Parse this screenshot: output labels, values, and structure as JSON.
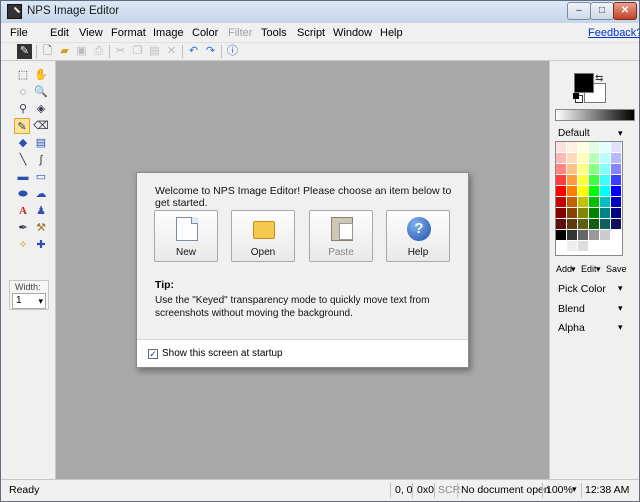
{
  "window": {
    "title": "NPS Image Editor",
    "controls": [
      "–",
      "□",
      "✕"
    ]
  },
  "menu": {
    "items": [
      "File",
      "Edit",
      "View",
      "Format",
      "Image",
      "Color",
      "Filter",
      "Tools",
      "Script",
      "Window",
      "Help"
    ],
    "disabled_item": "Filter",
    "feedback_link": "Feedback?"
  },
  "toolbar": {
    "icons": [
      "logo-icon",
      "new-icon",
      "open-icon",
      "save-icon",
      "print-icon",
      "cut-icon",
      "copy-icon",
      "paste-icon",
      "delete-icon",
      "undo-icon",
      "redo-icon",
      "help-icon"
    ]
  },
  "tools": {
    "width_label": "Width:",
    "width_value": "1",
    "active_tool": "pencil"
  },
  "right_panel": {
    "primary_color": "#000000",
    "secondary_color": "#ffffff",
    "palette_name": "Default",
    "palette_actions": {
      "add": "Add",
      "edit": "Edit",
      "save": "Save"
    },
    "options": [
      "Pick Color",
      "Blend",
      "Alpha"
    ]
  },
  "status": {
    "ready": "Ready",
    "coords": "0, 0",
    "size": "0x0",
    "scr": "SCR",
    "document": "No document open",
    "zoom": "100%",
    "time": "12:38 AM"
  },
  "dialog": {
    "welcome": "Welcome to NPS Image Editor! Please choose an item below to get started.",
    "buttons": {
      "new": "New",
      "open": "Open",
      "paste": "Paste",
      "help": "Help"
    },
    "help_glyph": "?",
    "tip_title": "Tip:",
    "tip_text": "Use the \"Keyed\" transparency mode to quickly move text from screenshots without moving the background.",
    "show_at_startup_label": "Show this screen at startup",
    "show_at_startup_checked": true
  },
  "colors": {
    "canvas": "#a8a8a8",
    "link": "#0033cc",
    "active_tool_highlight": "#fbe39a"
  }
}
